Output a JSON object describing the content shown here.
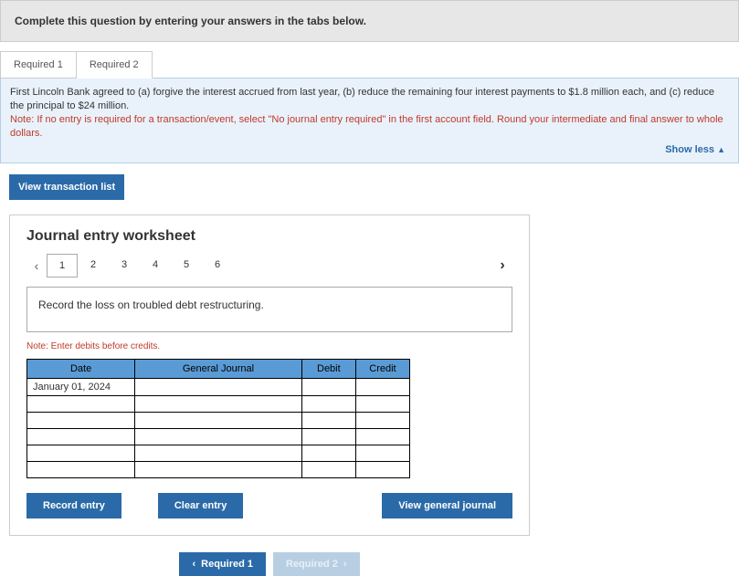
{
  "header": {
    "instruction": "Complete this question by entering your answers in the tabs below."
  },
  "tabs": [
    {
      "label": "Required 1"
    },
    {
      "label": "Required 2"
    }
  ],
  "bluebox": {
    "line1": "First Lincoln Bank agreed to (a) forgive the interest accrued from last year, (b) reduce the remaining four interest payments to $1.8 million each, and (c) reduce the principal to $24 million.",
    "note": "Note: If no entry is required for a transaction/event, select \"No journal entry required\" in the first account field. Round your intermediate and final answer to whole dollars.",
    "showless": "Show less"
  },
  "buttons": {
    "view_transaction_list": "View transaction list",
    "record_entry": "Record entry",
    "clear_entry": "Clear entry",
    "view_general_journal": "View general journal"
  },
  "worksheet": {
    "title": "Journal entry worksheet",
    "pager": [
      "1",
      "2",
      "3",
      "4",
      "5",
      "6"
    ],
    "active_page": "1",
    "description": "Record the loss on troubled debt restructuring.",
    "debits_note": "Note: Enter debits before credits.",
    "columns": {
      "date": "Date",
      "gj": "General Journal",
      "debit": "Debit",
      "credit": "Credit"
    },
    "rows": [
      {
        "date": "January 01, 2024",
        "gj": "",
        "debit": "",
        "credit": ""
      },
      {
        "date": "",
        "gj": "",
        "debit": "",
        "credit": ""
      },
      {
        "date": "",
        "gj": "",
        "debit": "",
        "credit": ""
      },
      {
        "date": "",
        "gj": "",
        "debit": "",
        "credit": ""
      },
      {
        "date": "",
        "gj": "",
        "debit": "",
        "credit": ""
      },
      {
        "date": "",
        "gj": "",
        "debit": "",
        "credit": ""
      }
    ]
  },
  "nav": {
    "prev": "Required 1",
    "next": "Required 2"
  }
}
